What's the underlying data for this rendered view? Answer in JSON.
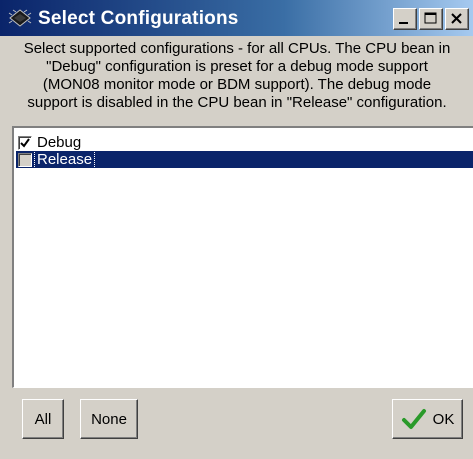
{
  "window": {
    "title": "Select Configurations",
    "icon": "cpu-chip-icon"
  },
  "title_buttons": {
    "minimize_icon": "minimize-icon",
    "maximize_icon": "maximize-icon",
    "close_icon": "close-icon"
  },
  "description": {
    "lines": [
      "Select supported configurations - for all CPUs. The CPU bean in",
      "\"Debug\" configuration is preset for a debug mode support",
      "(MON08 monitor mode or BDM support). The debug mode",
      "support is disabled in the CPU bean in \"Release\" configuration."
    ]
  },
  "list": {
    "items": [
      {
        "label": "Debug",
        "checked": true,
        "selected": false
      },
      {
        "label": "Release",
        "checked": false,
        "selected": true
      }
    ]
  },
  "buttons": {
    "all_label": "All",
    "none_label": "None",
    "ok_label": "OK",
    "ok_icon": "checkmark-icon"
  },
  "colors": {
    "title_bar_start": "#0a246a",
    "title_bar_end": "#a6caf0",
    "selection": "#0a246a",
    "window_face": "#d4d0c8",
    "ok_check": "#2a9a2a"
  }
}
